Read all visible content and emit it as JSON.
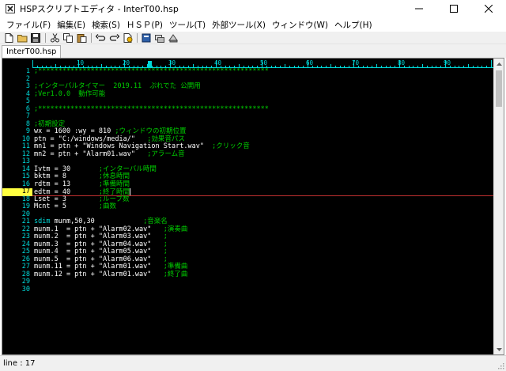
{
  "window": {
    "title": "HSPスクリプトエディタ - InterT00.hsp",
    "controls": [
      "minimize",
      "maximize",
      "close"
    ]
  },
  "menu": [
    {
      "label": "ファイル(F)"
    },
    {
      "label": "編集(E)"
    },
    {
      "label": "検索(S)"
    },
    {
      "label": "ＨＳＰ(P)"
    },
    {
      "label": "ツール(T)"
    },
    {
      "label": "外部ツール(X)"
    },
    {
      "label": "ウィンドウ(W)"
    },
    {
      "label": "ヘルプ(H)"
    }
  ],
  "toolbar": {
    "buttons": [
      "new-file-icon",
      "open-folder-icon",
      "save-icon",
      "cut-icon",
      "copy-icon",
      "paste-icon",
      "undo-icon",
      "redo-icon",
      "run-icon",
      "help-book-icon",
      "compile-icon",
      "debug-icon"
    ]
  },
  "tabs": [
    {
      "label": "InterT00.hsp",
      "active": true
    }
  ],
  "ruler": {
    "labels": [
      "10",
      "20",
      "30",
      "40",
      "50",
      "60",
      "70",
      "80",
      "90"
    ]
  },
  "editor": {
    "current_line": 17,
    "lines": [
      {
        "n": "1",
        "segments": [
          {
            "t": ";*********************************************************",
            "c": "comment"
          }
        ]
      },
      {
        "n": "2",
        "segments": []
      },
      {
        "n": "3",
        "segments": [
          {
            "t": ";インターバルタイマー  2019.11  ぷれでた 公開用",
            "c": "comment"
          }
        ]
      },
      {
        "n": "4",
        "segments": [
          {
            "t": ";Ver1.0.0  動作可能",
            "c": "comment"
          }
        ]
      },
      {
        "n": "5",
        "segments": []
      },
      {
        "n": "6",
        "segments": [
          {
            "t": ";*********************************************************",
            "c": "comment"
          }
        ]
      },
      {
        "n": "7",
        "segments": []
      },
      {
        "n": "8",
        "segments": [
          {
            "t": ";初期設定",
            "c": "comment"
          }
        ]
      },
      {
        "n": "9",
        "segments": [
          {
            "t": "wx = 1600 :wy = 810 ",
            "c": "plain"
          },
          {
            "t": ";ウィンドウの初期位置",
            "c": "comment"
          }
        ]
      },
      {
        "n": "10",
        "segments": [
          {
            "t": "ptn = \"C:/windows/media/\"   ",
            "c": "plain"
          },
          {
            "t": ";効果音パス",
            "c": "comment"
          }
        ]
      },
      {
        "n": "11",
        "segments": [
          {
            "t": "mn1 = ptn + \"Windows Navigation Start.wav\"  ",
            "c": "plain"
          },
          {
            "t": ";クリック音",
            "c": "comment"
          }
        ]
      },
      {
        "n": "12",
        "segments": [
          {
            "t": "mn2 = ptn + \"Alarm01.wav\"   ",
            "c": "plain"
          },
          {
            "t": ";アラーム音",
            "c": "comment"
          }
        ]
      },
      {
        "n": "13",
        "segments": []
      },
      {
        "n": "14",
        "segments": [
          {
            "t": "Ivtm = 30       ",
            "c": "plain"
          },
          {
            "t": ";インターバル時間",
            "c": "comment"
          }
        ]
      },
      {
        "n": "15",
        "segments": [
          {
            "t": "bktm = 8        ",
            "c": "plain"
          },
          {
            "t": ";休息時間",
            "c": "comment"
          }
        ]
      },
      {
        "n": "16",
        "segments": [
          {
            "t": "rdtm = 13       ",
            "c": "plain"
          },
          {
            "t": ";準備時間",
            "c": "comment"
          }
        ]
      },
      {
        "n": "17",
        "segments": [
          {
            "t": "edtm = 40       ",
            "c": "plain"
          },
          {
            "t": ";終了時間",
            "c": "comment"
          }
        ]
      },
      {
        "n": "18",
        "segments": [
          {
            "t": "Lset = 3        ",
            "c": "plain"
          },
          {
            "t": ";ループ数",
            "c": "comment"
          }
        ]
      },
      {
        "n": "19",
        "segments": [
          {
            "t": "Mcnt = 5        ",
            "c": "plain"
          },
          {
            "t": ";曲数",
            "c": "comment"
          }
        ]
      },
      {
        "n": "20",
        "segments": []
      },
      {
        "n": "21",
        "segments": [
          {
            "t": "sdim",
            "c": "kw"
          },
          {
            "t": " munm,50,30            ",
            "c": "plain"
          },
          {
            "t": ";音楽名",
            "c": "comment"
          }
        ]
      },
      {
        "n": "22",
        "segments": [
          {
            "t": "munm.1  = ptn + \"Alarm02.wav\"   ",
            "c": "plain"
          },
          {
            "t": ";演奏曲",
            "c": "comment"
          }
        ]
      },
      {
        "n": "23",
        "segments": [
          {
            "t": "munm.2  = ptn + \"Alarm03.wav\"   ",
            "c": "plain"
          },
          {
            "t": ";",
            "c": "comment"
          }
        ]
      },
      {
        "n": "24",
        "segments": [
          {
            "t": "munm.3  = ptn + \"Alarm04.wav\"   ",
            "c": "plain"
          },
          {
            "t": ";",
            "c": "comment"
          }
        ]
      },
      {
        "n": "25",
        "segments": [
          {
            "t": "munm.4  = ptn + \"Alarm05.wav\"   ",
            "c": "plain"
          },
          {
            "t": ";",
            "c": "comment"
          }
        ]
      },
      {
        "n": "26",
        "segments": [
          {
            "t": "munm.5  = ptn + \"Alarm06.wav\"   ",
            "c": "plain"
          },
          {
            "t": ";",
            "c": "comment"
          }
        ]
      },
      {
        "n": "27",
        "segments": [
          {
            "t": "munm.11 = ptn + \"Alarm01.wav\"   ",
            "c": "plain"
          },
          {
            "t": ";準備曲",
            "c": "comment"
          }
        ]
      },
      {
        "n": "28",
        "segments": [
          {
            "t": "munm.12 = ptn + \"Alarm01.wav\"   ",
            "c": "plain"
          },
          {
            "t": ";終了曲",
            "c": "comment"
          }
        ]
      },
      {
        "n": "29",
        "segments": []
      },
      {
        "n": "30",
        "segments": []
      }
    ]
  },
  "status": {
    "text": "line : 17"
  },
  "colors": {
    "editor_bg": "#000000",
    "line_number": "#00d7d7",
    "current_line_number_bg": "#ffff40",
    "comment": "#00d000",
    "keyword": "#00d7d7",
    "plain": "#ffffff",
    "cursor_line": "#c03030"
  }
}
